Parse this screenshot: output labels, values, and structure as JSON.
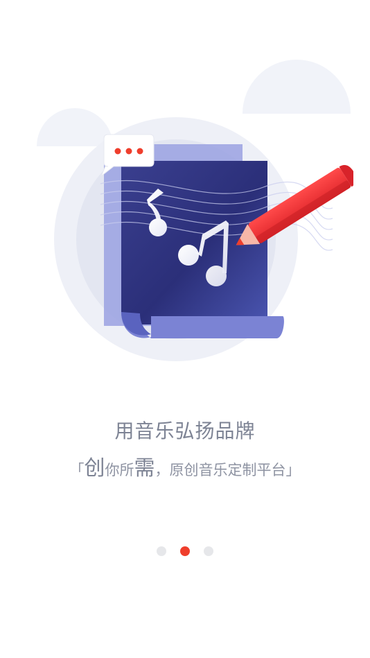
{
  "onboarding": {
    "headline": "用音乐弘扬品牌",
    "subline": {
      "open_bracket": "「",
      "char_chuang": "创",
      "text_ni_suo": "你所",
      "char_xu": "需",
      "text_rest": "，原创音乐定制平台",
      "close_bracket": "」"
    },
    "illustration_icon": "music-sheet-with-pencil-icon",
    "pagination": {
      "total": 3,
      "active_index": 1
    }
  },
  "colors": {
    "accent": "#ef3e2c",
    "text": "#7d8394",
    "dot_inactive": "#e6e7ea",
    "cloud": "#f1f3f9",
    "sheet_dark": "#2b2f79",
    "sheet_light": "#8b92dc"
  }
}
